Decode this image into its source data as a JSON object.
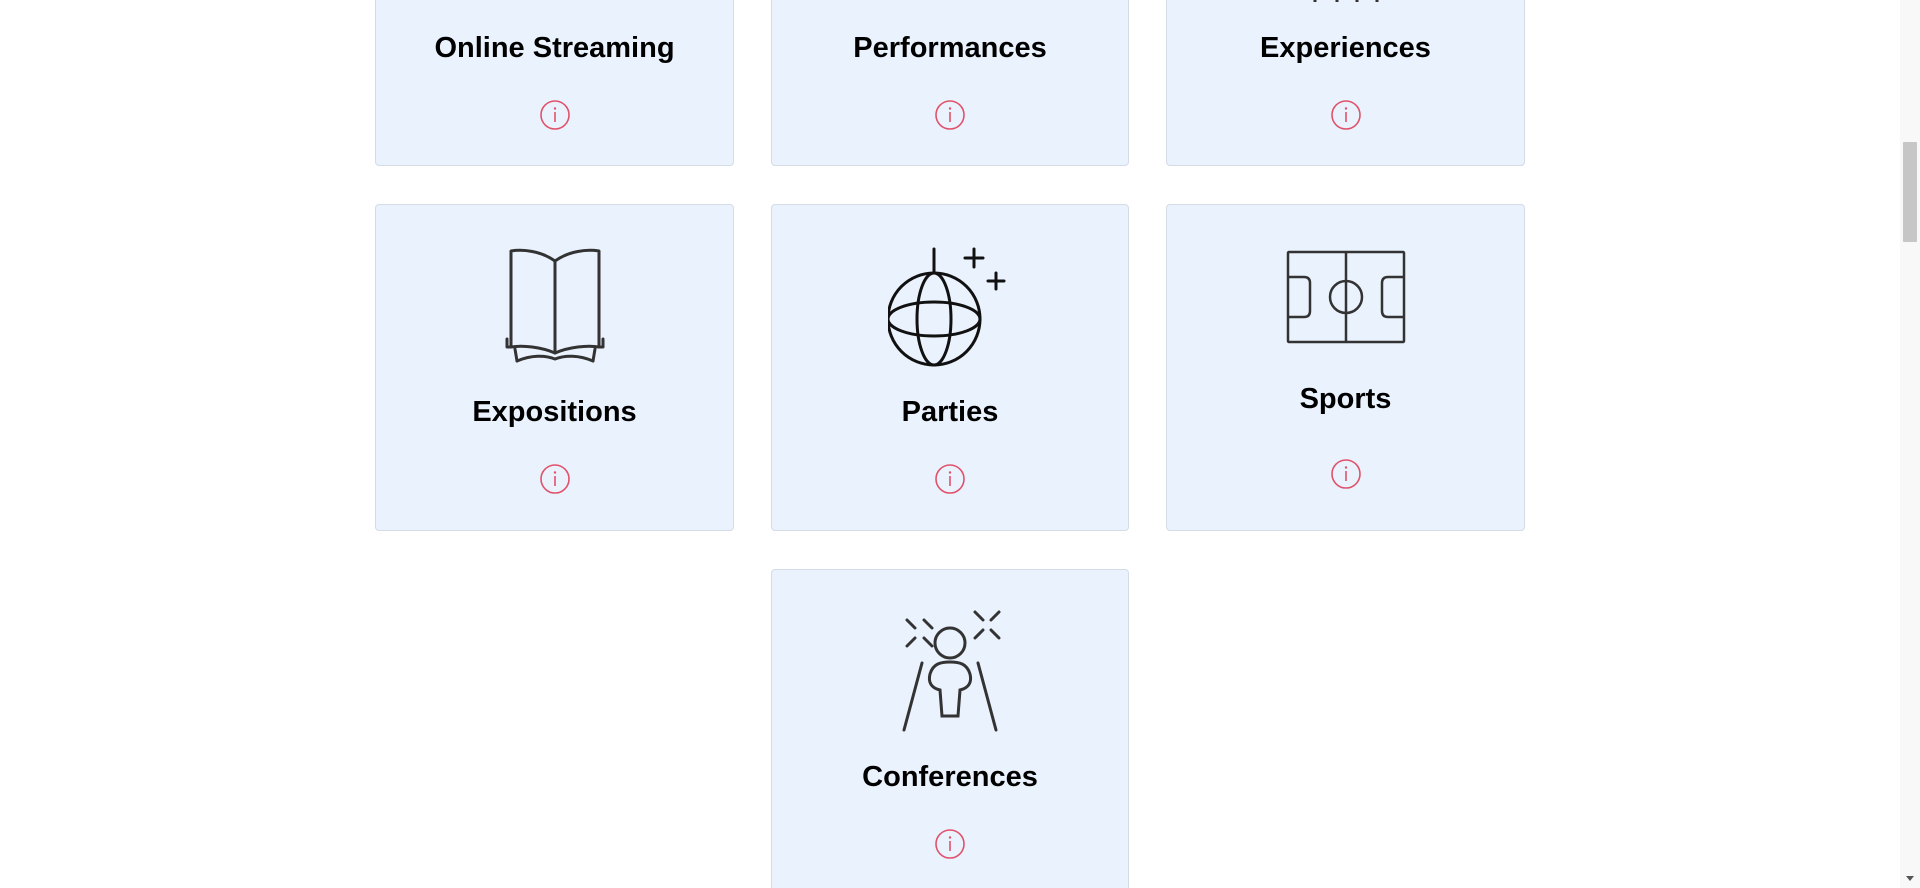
{
  "cards": [
    {
      "title": "Online Streaming",
      "icon": "none",
      "info_icon": "info-icon"
    },
    {
      "title": "Performances",
      "icon": "none",
      "info_icon": "info-icon"
    },
    {
      "title": "Experiences",
      "icon": "cropped",
      "info_icon": "info-icon"
    },
    {
      "title": "Expositions",
      "icon": "open-book-icon",
      "info_icon": "info-icon"
    },
    {
      "title": "Parties",
      "icon": "disco-ball-icon",
      "info_icon": "info-icon"
    },
    {
      "title": "Sports",
      "icon": "football-field-icon",
      "info_icon": "info-icon"
    },
    {
      "title": "Conferences",
      "icon": "speaker-spotlight-icon",
      "info_icon": "info-icon"
    }
  ],
  "colors": {
    "card_background": "#eaf2fd",
    "card_border": "#d4dce6",
    "info_icon": "#e0526a",
    "icon_stroke": "#333333"
  }
}
